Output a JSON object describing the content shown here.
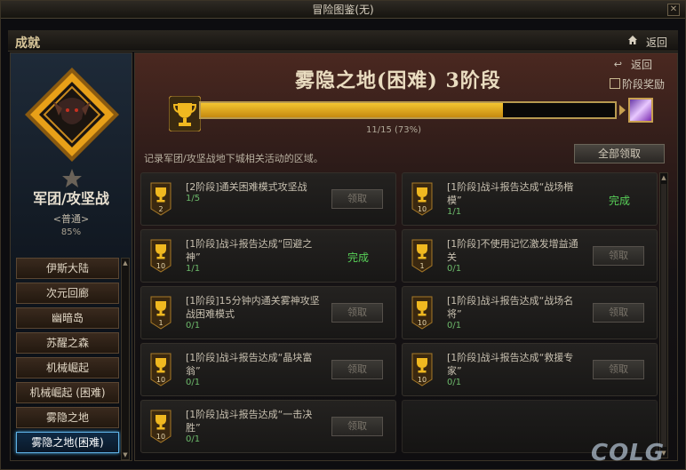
{
  "window": {
    "title": "冒险图鉴(无)",
    "close_icon": "close-icon"
  },
  "header": {
    "section_title": "成就",
    "back_label": "返回"
  },
  "category": {
    "title": "军团/攻坚战",
    "difficulty": "<普通>",
    "percent": "85%"
  },
  "zones": [
    {
      "label": "伊斯大陆",
      "active": false
    },
    {
      "label": "次元回廊",
      "active": false
    },
    {
      "label": "幽暗岛",
      "active": false
    },
    {
      "label": "苏醒之森",
      "active": false
    },
    {
      "label": "机械崛起",
      "active": false
    },
    {
      "label": "机械崛起 (困难)",
      "active": false
    },
    {
      "label": "雾隐之地",
      "active": false
    },
    {
      "label": "雾隐之地(困难)",
      "active": true
    }
  ],
  "stage": {
    "title": "雾隐之地(困难) 3阶段",
    "back_label": "返回",
    "reward_label": "阶段奖励",
    "progress_text": "11/15 (73%)",
    "progress_fraction": 0.73
  },
  "description": "记录军团/攻坚战地下城相关活动的区域。",
  "claim_all_label": "全部领取",
  "achievements": [
    {
      "title": "[2阶段]通关困难模式攻坚战",
      "progress": "1/5",
      "badge": "2",
      "status": "claim",
      "status_label": "领取"
    },
    {
      "title": "[1阶段]战斗报告达成“战场楷模”",
      "progress": "1/1",
      "badge": "10",
      "status": "done",
      "status_label": "完成"
    },
    {
      "title": "[1阶段]战斗报告达成“回避之神”",
      "progress": "1/1",
      "badge": "10",
      "status": "done",
      "status_label": "完成"
    },
    {
      "title": "[1阶段]不使用记忆激发增益通关",
      "progress": "0/1",
      "badge": "1",
      "status": "claim",
      "status_label": "领取"
    },
    {
      "title": "[1阶段]15分钟内通关雾神攻坚战困难模式",
      "progress": "0/1",
      "badge": "1",
      "status": "claim",
      "status_label": "领取"
    },
    {
      "title": "[1阶段]战斗报告达成“战场名将”",
      "progress": "0/1",
      "badge": "10",
      "status": "claim",
      "status_label": "领取"
    },
    {
      "title": "[1阶段]战斗报告达成“晶块富翁”",
      "progress": "0/1",
      "badge": "10",
      "status": "claim",
      "status_label": "领取"
    },
    {
      "title": "[1阶段]战斗报告达成“救援专家”",
      "progress": "0/1",
      "badge": "10",
      "status": "claim",
      "status_label": "领取"
    },
    {
      "title": "[1阶段]战斗报告达成“一击决胜”",
      "progress": "0/1",
      "badge": "10",
      "status": "claim",
      "status_label": "领取"
    }
  ],
  "colors": {
    "accent_gold": "#f4c430",
    "done_green": "#58d058",
    "active_blue": "#5fb2e6"
  },
  "watermark": "COLG"
}
